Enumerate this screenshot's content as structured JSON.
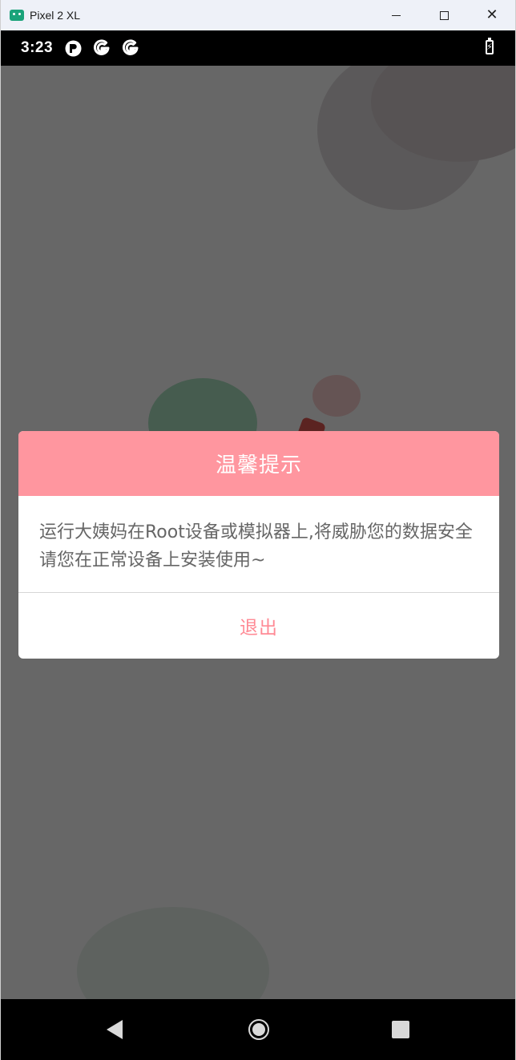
{
  "window": {
    "title": "Pixel 2 XL",
    "minimize_glyph": "—",
    "maximize_glyph": "☐",
    "close_glyph": "✕"
  },
  "status_bar": {
    "time": "3:23",
    "notification_icons": [
      "p-icon",
      "google-icon",
      "google-icon"
    ],
    "battery_icon": "battery-charging-icon"
  },
  "dialog": {
    "title": "温馨提示",
    "message": "运行大姨妈在Root设备或模拟器上,将威胁您的数据安全请您在正常设备上安装使用~",
    "exit_button": "退出",
    "header_color": "#ff969f",
    "button_color": "#ff8a95"
  },
  "nav_bar": {
    "icons": [
      "back-icon",
      "home-icon",
      "recents-icon"
    ]
  }
}
